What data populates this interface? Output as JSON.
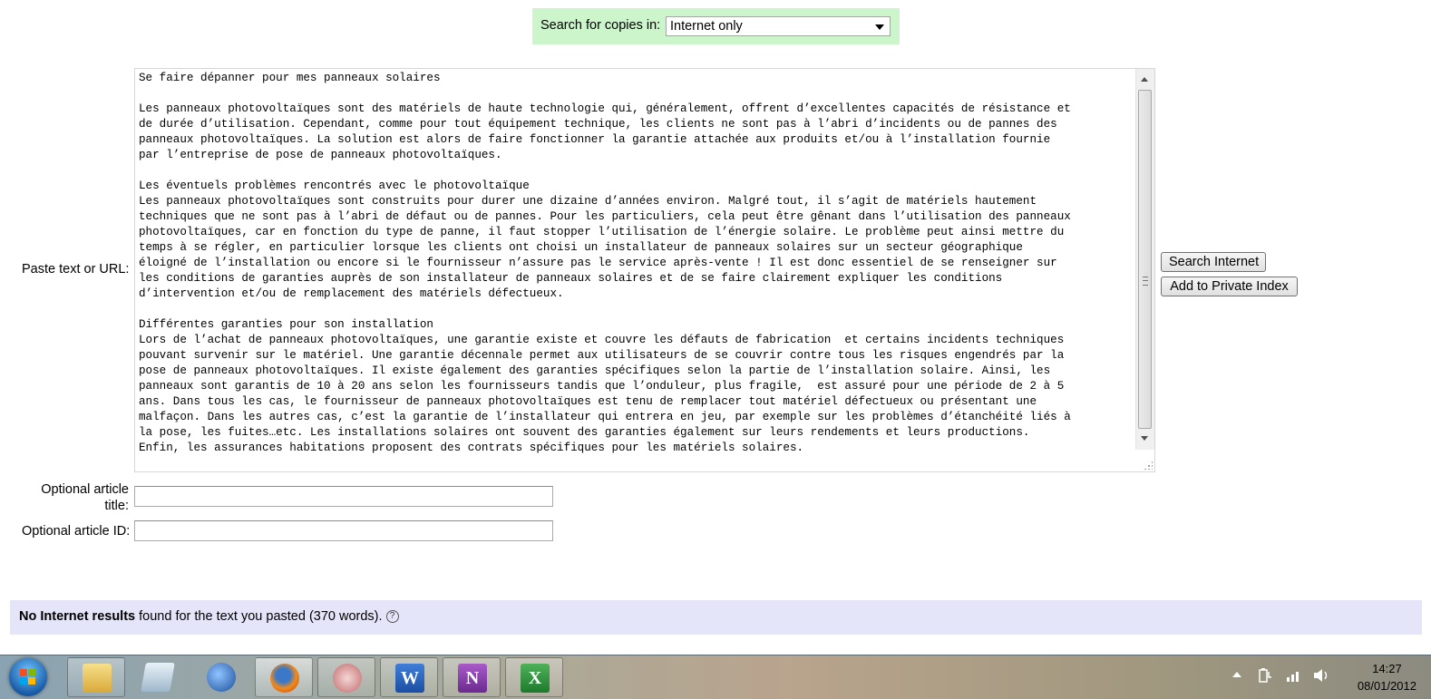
{
  "search_bar": {
    "label": "Search for copies in:",
    "scope_value": "Internet only"
  },
  "form": {
    "paste_label": "Paste text or URL:",
    "pasted_text": "Se faire dépanner pour mes panneaux solaires\n\nLes panneaux photovoltaïques sont des matériels de haute technologie qui, généralement, offrent d’excellentes capacités de résistance et\nde durée d’utilisation. Cependant, comme pour tout équipement technique, les clients ne sont pas à l’abri d’incidents ou de pannes des\npanneaux photovoltaïques. La solution est alors de faire fonctionner la garantie attachée aux produits et/ou à l’installation fournie\npar l’entreprise de pose de panneaux photovoltaïques.\n\nLes éventuels problèmes rencontrés avec le photovoltaïque\nLes panneaux photovoltaïques sont construits pour durer une dizaine d’années environ. Malgré tout, il s’agit de matériels hautement\ntechniques que ne sont pas à l’abri de défaut ou de pannes. Pour les particuliers, cela peut être gênant dans l’utilisation des panneaux\nphotovoltaïques, car en fonction du type de panne, il faut stopper l’utilisation de l’énergie solaire. Le problème peut ainsi mettre du\ntemps à se régler, en particulier lorsque les clients ont choisi un installateur de panneaux solaires sur un secteur géographique\néloigné de l’installation ou encore si le fournisseur n’assure pas le service après-vente ! Il est donc essentiel de se renseigner sur\nles conditions de garanties auprès de son installateur de panneaux solaires et de se faire clairement expliquer les conditions\nd’intervention et/ou de remplacement des matériels défectueux.\n\nDifférentes garanties pour son installation\nLors de l’achat de panneaux photovoltaïques, une garantie existe et couvre les défauts de fabrication  et certains incidents techniques\npouvant survenir sur le matériel. Une garantie décennale permet aux utilisateurs de se couvrir contre tous les risques engendrés par la\npose de panneaux photovoltaïques. Il existe également des garanties spécifiques selon la partie de l’installation solaire. Ainsi, les\npanneaux sont garantis de 10 à 20 ans selon les fournisseurs tandis que l’onduleur, plus fragile,  est assuré pour une période de 2 à 5\nans. Dans tous les cas, le fournisseur de panneaux photovoltaïques est tenu de remplacer tout matériel défectueux ou présentant une\nmalfaçon. Dans les autres cas, c’est la garantie de l’installateur qui entrera en jeu, par exemple sur les problèmes d’étanchéité liés à\nla pose, les fuites…etc. Les installations solaires ont souvent des garanties également sur leurs rendements et leurs productions.\nEnfin, les assurances habitations proposent des contrats spécifiques pour les matériels solaires.",
    "search_internet_button": "Search Internet",
    "add_private_button": "Add to Private Index",
    "title_label_line1": "Optional article",
    "title_label_line2": "title:",
    "title_value": "",
    "id_label": "Optional article ID:",
    "id_value": ""
  },
  "results": {
    "bold": "No Internet results",
    "rest": " found for the text you pasted (370 words).",
    "help_glyph": "?"
  },
  "taskbar": {
    "apps": [
      "windows-explorer",
      "notepad",
      "thunderbird",
      "firefox",
      "snipping-tool",
      "word",
      "onenote",
      "excel"
    ],
    "clock_time": "14:27",
    "clock_date": "08/01/2012"
  }
}
